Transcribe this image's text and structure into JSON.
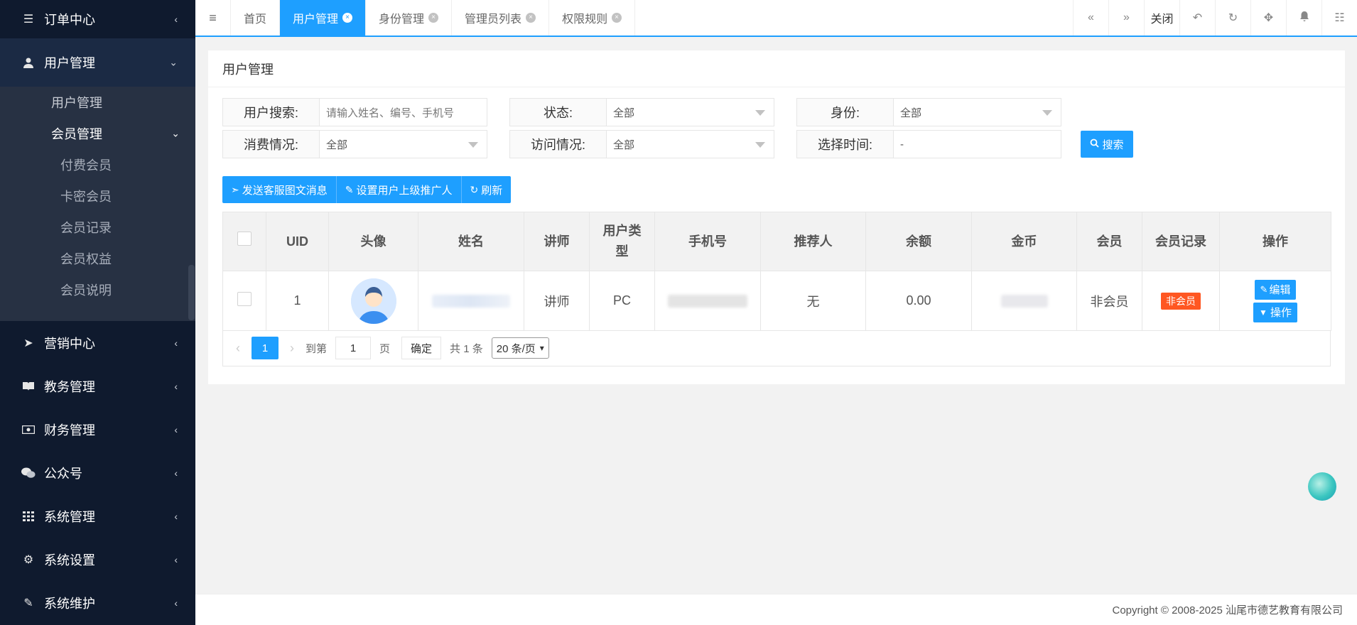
{
  "sidebar": {
    "items": [
      {
        "label": "订单中心",
        "icon": "list-icon"
      },
      {
        "label": "用户管理",
        "icon": "user-icon"
      },
      {
        "label": "营销中心",
        "icon": "paper-plane-icon"
      },
      {
        "label": "教务管理",
        "icon": "book-icon"
      },
      {
        "label": "财务管理",
        "icon": "money-icon"
      },
      {
        "label": "公众号",
        "icon": "wechat-icon"
      },
      {
        "label": "系统管理",
        "icon": "grid-icon"
      },
      {
        "label": "系统设置",
        "icon": "gear-icon"
      },
      {
        "label": "系统维护",
        "icon": "wand-icon"
      }
    ],
    "user_sub": [
      "用户管理",
      "会员管理"
    ],
    "member_sub": [
      "付费会员",
      "卡密会员",
      "会员记录",
      "会员权益",
      "会员说明"
    ]
  },
  "tabs": [
    {
      "label": "首页",
      "closable": false
    },
    {
      "label": "用户管理",
      "closable": true,
      "active": true
    },
    {
      "label": "身份管理",
      "closable": true
    },
    {
      "label": "管理员列表",
      "closable": true
    },
    {
      "label": "权限规则",
      "closable": true
    }
  ],
  "topbar": {
    "close_label": "关闭"
  },
  "card": {
    "title": "用户管理"
  },
  "filters": {
    "search_label": "用户搜索:",
    "search_placeholder": "请输入姓名、编号、手机号",
    "status_label": "状态:",
    "status_value": "全部",
    "identity_label": "身份:",
    "identity_value": "全部",
    "consume_label": "消费情况:",
    "consume_value": "全部",
    "visit_label": "访问情况:",
    "visit_value": "全部",
    "time_label": "选择时间:",
    "time_value": "-",
    "search_button": "搜索"
  },
  "toolbar": {
    "send_msg": "发送客服图文消息",
    "set_promoter": "设置用户上级推广人",
    "refresh": "刷新"
  },
  "table": {
    "headers": [
      "UID",
      "头像",
      "姓名",
      "讲师",
      "用户类型",
      "手机号",
      "推荐人",
      "余额",
      "金币",
      "会员",
      "会员记录",
      "操作"
    ],
    "rows": [
      {
        "uid": "1",
        "teacher": "讲师",
        "user_type": "PC",
        "referrer": "无",
        "balance": "0.00",
        "member": "非会员",
        "member_record": "非会员",
        "edit": "编辑",
        "action": "操作"
      }
    ]
  },
  "pager": {
    "current": "1",
    "goto_label": "到第",
    "goto_value": "1",
    "page_label": "页",
    "confirm": "确定",
    "total": "共 1 条",
    "per_page": "20 条/页"
  },
  "footer": {
    "copyright": "Copyright © 2008-2025 汕尾市德艺教育有限公司"
  }
}
